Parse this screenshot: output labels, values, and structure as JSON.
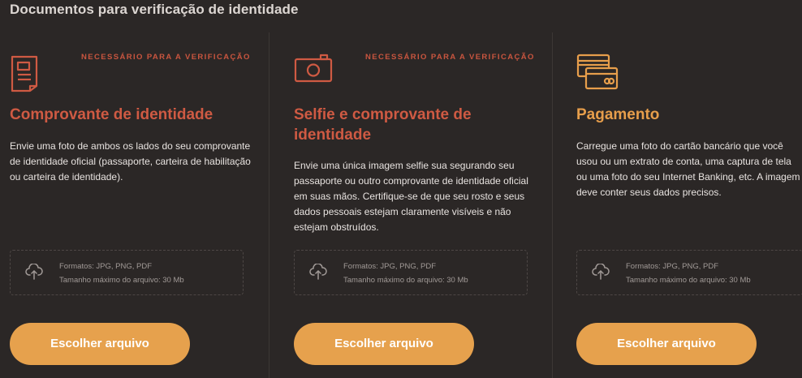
{
  "page": {
    "title": "Documentos para verificação de identidade"
  },
  "colors": {
    "background": "#2b2726",
    "accent_red": "#cf5a43",
    "accent_orange": "#e6a14d",
    "text": "#e8e3e0",
    "muted": "#a19a97"
  },
  "cards": [
    {
      "icon": "document-icon",
      "badge": "NECESSÁRIO PARA A VERIFICAÇÃO",
      "title": "Comprovante de identidade",
      "description": "Envie uma foto de ambos os lados do seu comprovante de identidade oficial (passaporte, carteira de habilitação ou carteira de identidade).",
      "dropzone": {
        "formats": "Formatos: JPG, PNG, PDF",
        "max_size": "Tamanho máximo do arquivo: 30 Mb"
      },
      "button": "Escolher arquivo"
    },
    {
      "icon": "camera-icon",
      "badge": "NECESSÁRIO PARA A VERIFICAÇÃO",
      "title": "Selfie e comprovante de identidade",
      "description": "Envie uma única imagem selfie sua segurando seu passaporte ou outro comprovante de identidade oficial em suas mãos. Certifique-se de que seu rosto e seus dados pessoais estejam claramente visíveis e não estejam obstruídos.",
      "dropzone": {
        "formats": "Formatos: JPG, PNG, PDF",
        "max_size": "Tamanho máximo do arquivo: 30 Mb"
      },
      "button": "Escolher arquivo"
    },
    {
      "icon": "credit-card-icon",
      "title": "Pagamento",
      "description": "Carregue uma foto do cartão bancário que você usou ou um extrato de conta, uma captura de tela ou uma foto do seu Internet Banking, etc. A imagem deve conter seus dados precisos.",
      "dropzone": {
        "formats": "Formatos: JPG, PNG, PDF",
        "max_size": "Tamanho máximo do arquivo: 30 Mb"
      },
      "button": "Escolher arquivo"
    }
  ]
}
